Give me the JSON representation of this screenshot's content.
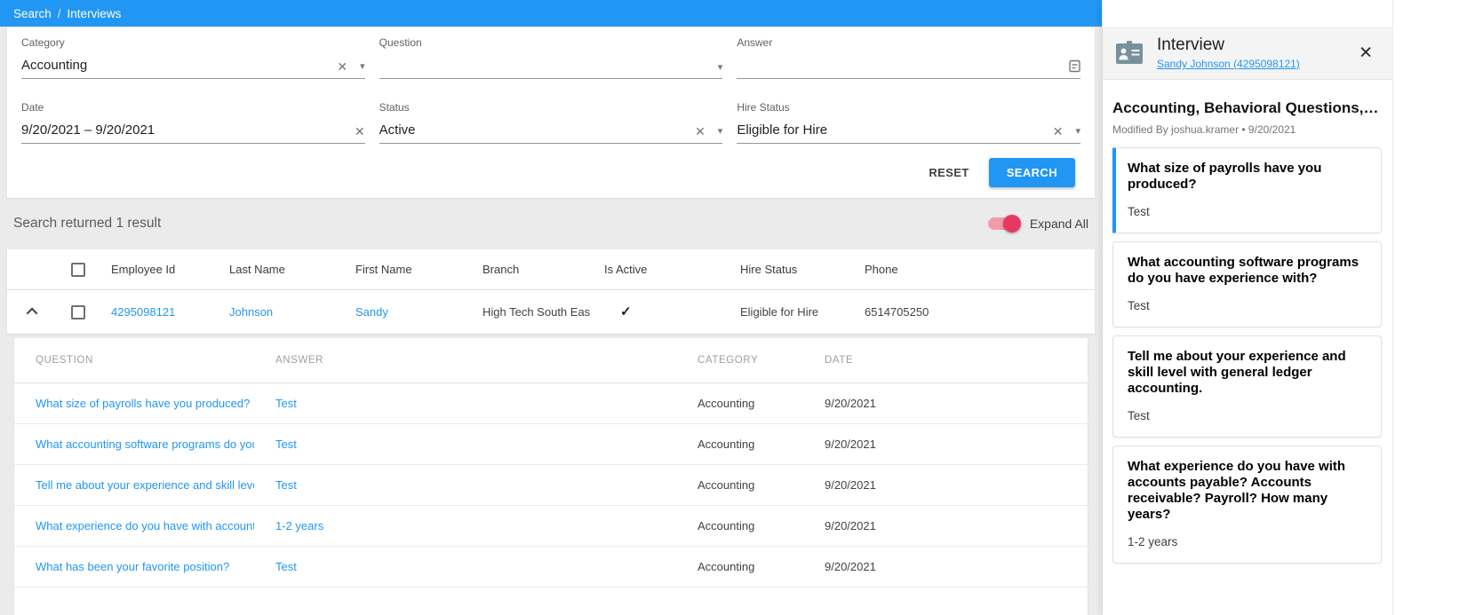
{
  "breadcrumb": {
    "search": "Search",
    "separator": "/",
    "current": "Interviews"
  },
  "icons": {
    "clear": "✕",
    "caret": "▾",
    "check": "✓",
    "close": "✕"
  },
  "filters": {
    "category": {
      "label": "Category",
      "value": "Accounting"
    },
    "question": {
      "label": "Question",
      "value": ""
    },
    "answer": {
      "label": "Answer",
      "value": ""
    },
    "date": {
      "label": "Date",
      "value": "9/20/2021  –  9/20/2021"
    },
    "status": {
      "label": "Status",
      "value": "Active"
    },
    "hire_status": {
      "label": "Hire Status",
      "value": "Eligible for Hire"
    },
    "reset_label": "RESET",
    "search_label": "SEARCH"
  },
  "results": {
    "summary": "Search returned 1 result",
    "expand_all_label": "Expand All",
    "table": {
      "headers": [
        "Employee Id",
        "Last Name",
        "First Name",
        "Branch",
        "Is Active",
        "Hire Status",
        "Phone"
      ],
      "row": {
        "employee_id": "4295098121",
        "last_name": "Johnson",
        "first_name": "Sandy",
        "branch": "High Tech South East",
        "hire_status": "Eligible for Hire",
        "phone": "6514705250"
      }
    },
    "detail_table": {
      "headers": [
        "QUESTION",
        "ANSWER",
        "CATEGORY",
        "DATE"
      ],
      "rows": [
        {
          "question": "What size of payrolls have you produced?",
          "answer": "Test",
          "category": "Accounting",
          "date": "9/20/2021"
        },
        {
          "question": "What accounting software programs do you h…",
          "answer": "Test",
          "category": "Accounting",
          "date": "9/20/2021"
        },
        {
          "question": "Tell me about your experience and skill level …",
          "answer": "Test",
          "category": "Accounting",
          "date": "9/20/2021"
        },
        {
          "question": "What experience do you have with accounts p…",
          "answer": "1-2 years",
          "category": "Accounting",
          "date": "9/20/2021"
        },
        {
          "question": "What has been your favorite position?",
          "answer": "Test",
          "category": "Accounting",
          "date": "9/20/2021"
        }
      ]
    }
  },
  "panel": {
    "title": "Interview",
    "subject_link": "Sandy Johnson (4295098121)",
    "record_title": "Accounting, Behavioral Questions, …",
    "modified_line": "Modified By joshua.kramer • 9/20/2021",
    "qa_cards": [
      {
        "question": "What size of payrolls have you produced?",
        "answer": "Test"
      },
      {
        "question": "What accounting software programs do you have experience with?",
        "answer": "Test"
      },
      {
        "question": "Tell me about your experience and skill level with general ledger accounting.",
        "answer": "Test"
      },
      {
        "question": "What experience do you have with accounts payable? Accounts receivable? Payroll? How many years?",
        "answer": "1-2 years"
      }
    ]
  },
  "colors": {
    "accent": "#2196f3",
    "link": "#2196f3",
    "toggle-knob": "#e5395f",
    "toggle-track": "#f49ba9",
    "panel-icon": "#78909c"
  }
}
